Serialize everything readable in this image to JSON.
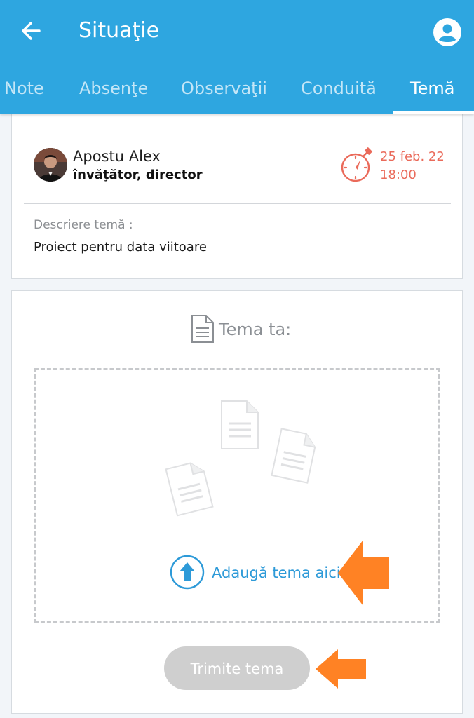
{
  "header": {
    "title": "Situaţie",
    "back_icon": "arrow-left-icon",
    "account_icon": "account-circle-icon"
  },
  "tabs": [
    {
      "label": "Note",
      "active": false
    },
    {
      "label": "Absenţe",
      "active": false
    },
    {
      "label": "Observaţii",
      "active": false
    },
    {
      "label": "Conduită",
      "active": false
    },
    {
      "label": "Temă",
      "active": true
    }
  ],
  "assignment": {
    "teacher_name": "Apostu Alex",
    "teacher_role": "învăţător, director",
    "deadline_date": "25 feb. 22",
    "deadline_time": "18:00",
    "deadline_icon": "stopwatch-icon",
    "description_label": "Descriere temă :",
    "description_text": "Proiect pentru data viitoare"
  },
  "submission": {
    "section_label": "Tema ta:",
    "section_icon": "document-icon",
    "upload_label": "Adaugă tema aici",
    "upload_icon": "upload-arrow-icon",
    "submit_label": "Trimite tema",
    "submit_enabled": false
  },
  "colors": {
    "app_bar": "#2ea6e0",
    "accent_blue": "#2d9ad8",
    "deadline_red": "#ea6a5a",
    "annotation_orange": "#ff8224",
    "disabled_button": "#cfcfcf"
  }
}
